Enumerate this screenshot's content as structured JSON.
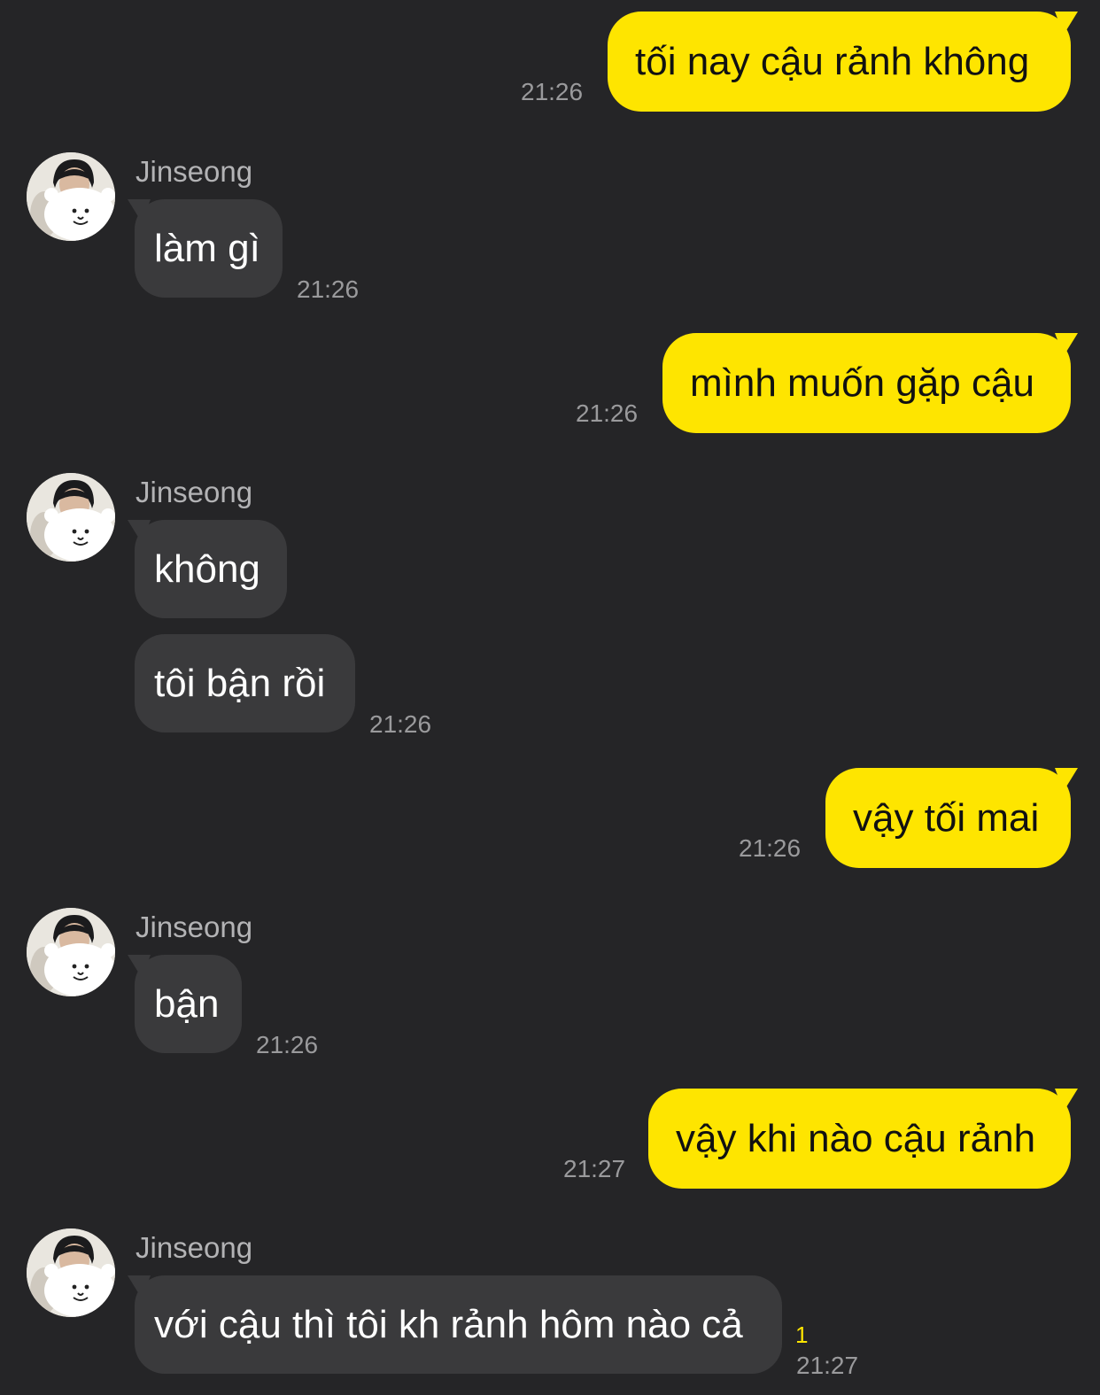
{
  "colors": {
    "background": "#252527",
    "outgoing_bubble": "#fee500",
    "incoming_bubble": "#3a3a3c",
    "unread": "#fee500"
  },
  "contact": {
    "name": "Jinseong",
    "avatar_icon": "avatar-icon"
  },
  "messages": [
    {
      "direction": "out",
      "text": "tối nay cậu rảnh không",
      "time": "21:26"
    },
    {
      "direction": "in",
      "sender": "Jinseong",
      "text": "làm gì",
      "time": "21:26"
    },
    {
      "direction": "out",
      "text": "mình muốn gặp cậu",
      "time": "21:26"
    },
    {
      "direction": "in",
      "sender": "Jinseong",
      "text": "không"
    },
    {
      "direction": "in",
      "text": "tôi bận rồi",
      "time": "21:26"
    },
    {
      "direction": "out",
      "text": "vậy tối mai",
      "time": "21:26"
    },
    {
      "direction": "in",
      "sender": "Jinseong",
      "text": "bận",
      "time": "21:26"
    },
    {
      "direction": "out",
      "text": "vậy khi nào cậu rảnh",
      "time": "21:27"
    },
    {
      "direction": "in",
      "sender": "Jinseong",
      "text": "với cậu thì tôi kh rảnh hôm nào cả",
      "time": "21:27",
      "unread_count": "1"
    }
  ]
}
